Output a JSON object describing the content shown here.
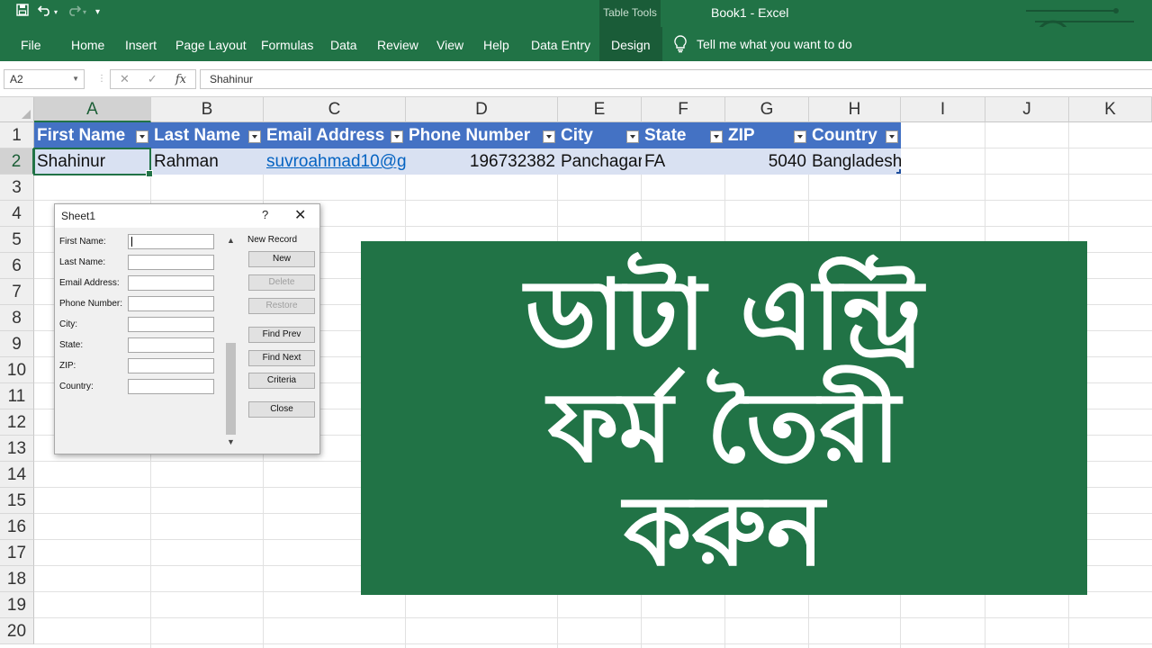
{
  "qat": {
    "save_icon": "save-icon",
    "undo_icon": "undo-icon",
    "redo_icon": "redo-icon",
    "customize_icon": "customize-qat-icon"
  },
  "titlebar": {
    "contextual_group": "Table Tools",
    "title": "Book1  -  Excel"
  },
  "ribbon": {
    "tabs": [
      {
        "label": "File"
      },
      {
        "label": "Home"
      },
      {
        "label": "Insert"
      },
      {
        "label": "Page Layout"
      },
      {
        "label": "Formulas"
      },
      {
        "label": "Data"
      },
      {
        "label": "Review"
      },
      {
        "label": "View"
      },
      {
        "label": "Help"
      },
      {
        "label": "Data Entry"
      },
      {
        "label": "Design"
      }
    ],
    "tell_me": "Tell me what you want to do"
  },
  "formula_bar": {
    "name_box": "A2",
    "cancel": "✕",
    "enter": "✓",
    "fx": "fx",
    "value": "Shahinur"
  },
  "grid": {
    "columns": [
      "A",
      "B",
      "C",
      "D",
      "E",
      "F",
      "G",
      "H",
      "I",
      "J",
      "K"
    ],
    "rows": [
      "1",
      "2",
      "3",
      "4",
      "5",
      "6",
      "7",
      "8",
      "9",
      "10",
      "11",
      "12",
      "13",
      "14",
      "15",
      "16",
      "17",
      "18",
      "19",
      "20"
    ],
    "headers": [
      "First Name",
      "Last Name",
      "Email Address",
      "Phone Number",
      "City",
      "State",
      "ZIP",
      "Country"
    ],
    "record": [
      "Shahinur",
      "Rahman",
      "suvroahmad10@g",
      "196732382",
      "Panchagar",
      "FA",
      "5040",
      "Bangladesh"
    ]
  },
  "dialog": {
    "title": "Sheet1",
    "help": "?",
    "close": "✕",
    "fields": [
      {
        "label": "First Name:"
      },
      {
        "label": "Last Name:"
      },
      {
        "label": "Email Address:"
      },
      {
        "label": "Phone Number:"
      },
      {
        "label": "City:"
      },
      {
        "label": "State:"
      },
      {
        "label": "ZIP:"
      },
      {
        "label": "Country:"
      }
    ],
    "record_status": "New Record",
    "buttons": {
      "new": "New",
      "delete": "Delete",
      "restore": "Restore",
      "find_prev": "Find Prev",
      "find_next": "Find Next",
      "criteria": "Criteria",
      "close": "Close"
    }
  },
  "banner": {
    "lines": [
      "ডাটা এন্ট্রি",
      "ফর্ম তৈরী",
      "করুন"
    ],
    "color": "#217346"
  },
  "colors": {
    "excel_green": "#217346",
    "table_header": "#4472c4",
    "table_row": "#d9e1f2"
  }
}
